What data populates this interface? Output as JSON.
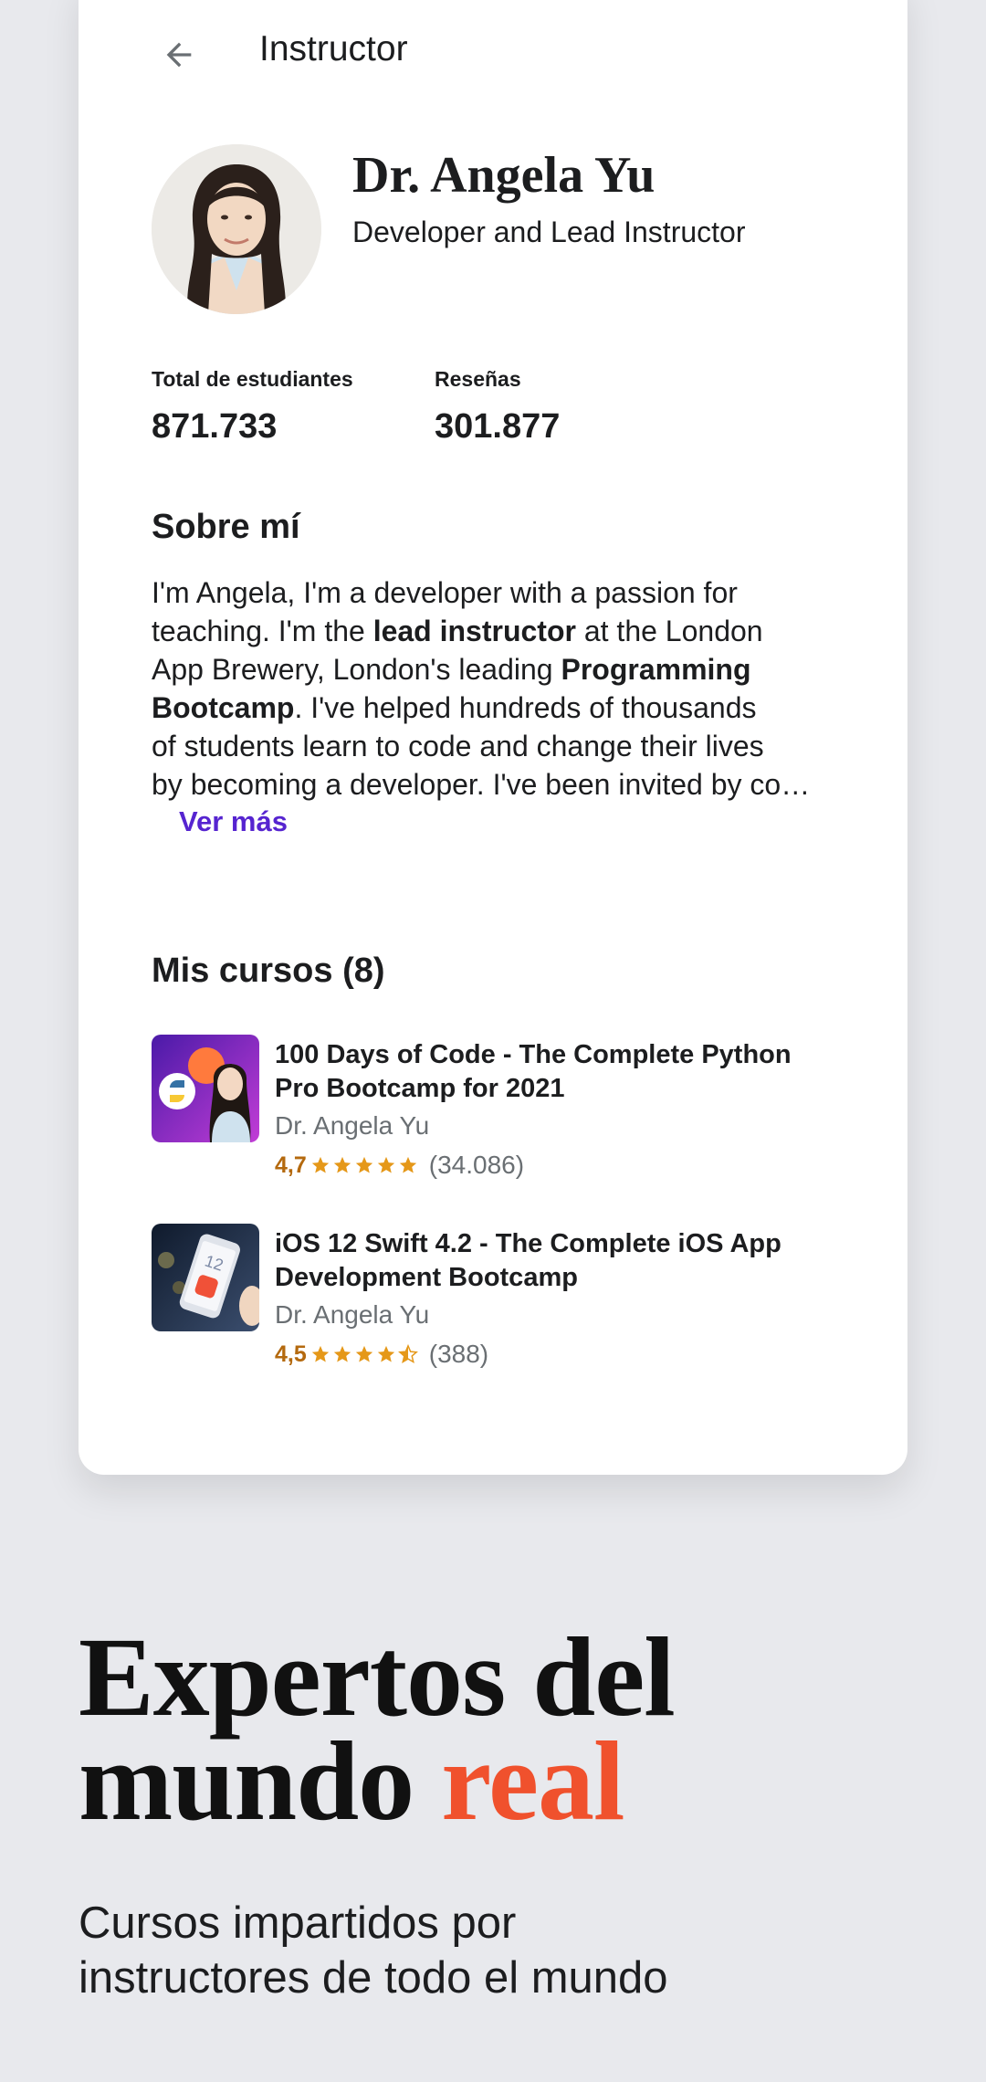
{
  "header": {
    "title": "Instructor"
  },
  "instructor": {
    "name": "Dr. Angela Yu",
    "headline": "Developer and Lead Instructor"
  },
  "stats": {
    "students_label": "Total de estudiantes",
    "students_value": "871.733",
    "reviews_label": "Reseñas",
    "reviews_value": "301.877"
  },
  "about": {
    "title": "Sobre mí",
    "lines": [
      "I'm Angela, I'm a developer with a passion for",
      "teaching. I'm the ",
      "lead instructor",
      " at the London",
      "App Brewery, London's leading ",
      "Programming",
      "Bootcamp",
      ". I've helped hundreds of thousands",
      "of students learn to code and change their lives",
      "by becoming a developer. I've been invited by co…"
    ],
    "more_label": "Ver más"
  },
  "courses": {
    "title": "Mis cursos (8)",
    "items": [
      {
        "title": "100 Days of Code - The Complete Python Pro Bootcamp for 2021",
        "author": "Dr. Angela Yu",
        "rating": "4,7",
        "rating_value": 4.7,
        "count": "(34.086)"
      },
      {
        "title": "iOS 12 Swift 4.2 - The Complete iOS App Development Bootcamp",
        "author": "Dr. Angela Yu",
        "rating": "4,5",
        "rating_value": 4.5,
        "count": "(388)"
      }
    ]
  },
  "marketing": {
    "hero_line1": "Expertos del",
    "hero_line2a": "mundo ",
    "hero_line2b": "real",
    "subtitle_line1": "Cursos impartidos por",
    "subtitle_line2": "instructores de todo el mundo"
  },
  "colors": {
    "accent": "#f0512d",
    "link": "#5624d0",
    "star": "#e59819",
    "rating_text": "#b4690e",
    "background": "#e8e9ed"
  },
  "icons": {
    "back": "arrow-left-icon",
    "star": "star-icon",
    "half_star": "star-half-icon"
  }
}
